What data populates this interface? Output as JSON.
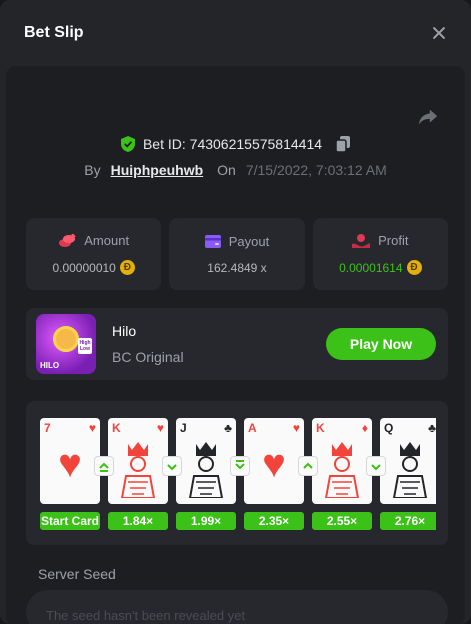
{
  "header": {
    "title": "Bet Slip"
  },
  "bet": {
    "id_text": "Bet ID: 74306215575814414",
    "by_label": "By",
    "user": "Huiphpeuhwb",
    "on_label": "On",
    "date": "7/15/2022, 7:03:12 AM"
  },
  "stats": [
    {
      "label": "Amount",
      "value": "0.00000010",
      "icon": "coins-icon",
      "coin": true,
      "value_color": "#b6b8bd"
    },
    {
      "label": "Payout",
      "value": "162.4849 x",
      "icon": "wallet-icon",
      "coin": false,
      "value_color": "#b6b8bd"
    },
    {
      "label": "Profit",
      "value": "0.00001614",
      "icon": "profit-icon",
      "coin": true,
      "value_color": "#3bc117"
    }
  ],
  "coin_symbol": "Đ",
  "game": {
    "name": "Hilo",
    "subtitle": "BC Original",
    "button": "Play Now",
    "thumb_text": "HILO",
    "thumb_high": "High",
    "thumb_low": "Low"
  },
  "cards": [
    {
      "rank": "7",
      "suit": "♥",
      "color": "red",
      "multiplier": "Start Card",
      "face": false
    },
    {
      "rank": "K",
      "suit": "♥",
      "color": "red",
      "multiplier": "1.84×",
      "face": true
    },
    {
      "rank": "J",
      "suit": "♣",
      "color": "black",
      "multiplier": "1.99×",
      "face": true
    },
    {
      "rank": "A",
      "suit": "♥",
      "color": "red",
      "multiplier": "2.35×",
      "face": false
    },
    {
      "rank": "K",
      "suit": "♦",
      "color": "red",
      "multiplier": "2.55×",
      "face": true
    },
    {
      "rank": "Q",
      "suit": "♣",
      "color": "black",
      "multiplier": "2.76×",
      "face": true
    }
  ],
  "guesses": [
    "higher-or-same-icon",
    "lower-icon",
    "lower-or-same-icon",
    "higher-icon",
    "lower-icon"
  ],
  "seed": {
    "label": "Server Seed",
    "placeholder": "The seed hasn't been revealed yet"
  },
  "colors": {
    "accent": "#3bc117",
    "coin": "#e2b00e",
    "red_suit": "#f2443a"
  }
}
